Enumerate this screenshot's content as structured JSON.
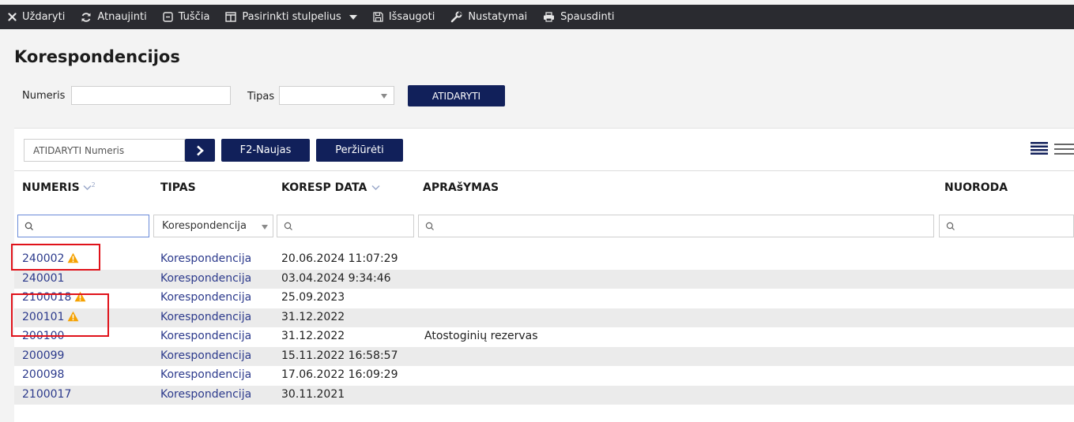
{
  "toolbar": {
    "items": [
      {
        "label": "Uždaryti",
        "icon": "close-icon"
      },
      {
        "label": "Atnaujinti",
        "icon": "refresh-icon"
      },
      {
        "label": "Tuščia",
        "icon": "empty-icon"
      },
      {
        "label": "Pasirinkti stulpelius",
        "icon": "columns-icon"
      },
      {
        "label": "Išsaugoti",
        "icon": "save-icon"
      },
      {
        "label": "Nustatymai",
        "icon": "wrench-icon"
      },
      {
        "label": "Spausdinti",
        "icon": "print-icon"
      }
    ]
  },
  "page": {
    "title": "Korespondencijos"
  },
  "filters": {
    "numeris_label": "Numeris",
    "numeris_value": "",
    "tipas_label": "Tipas",
    "tipas_value": "",
    "open_button": "ATIDARYTI"
  },
  "quickbar": {
    "open_placeholder": "ATIDARYTI Numeris",
    "new_button": "F2-Naujas",
    "view_button": "Peržiūrėti"
  },
  "table": {
    "columns": {
      "numeris": "NUMERIS",
      "numeris_sort": "2",
      "tipas": "TIPAS",
      "koresp_data": "KORESP DATA",
      "aprasymas": "APRAšYMAS",
      "nuoroda": "NUORODA"
    },
    "type_filter_value": "Korespondencija",
    "rows": [
      {
        "numeris": "240002",
        "warning": true,
        "tipas": "Korespondencija",
        "data": "20.06.2024 11:07:29",
        "aprasymas": ""
      },
      {
        "numeris": "240001",
        "warning": false,
        "tipas": "Korespondencija",
        "data": "03.04.2024 9:34:46",
        "aprasymas": ""
      },
      {
        "numeris": "2100018",
        "warning": true,
        "tipas": "Korespondencija",
        "data": "25.09.2023",
        "aprasymas": ""
      },
      {
        "numeris": "200101",
        "warning": true,
        "tipas": "Korespondencija",
        "data": "31.12.2022",
        "aprasymas": ""
      },
      {
        "numeris": "200100",
        "warning": false,
        "tipas": "Korespondencija",
        "data": "31.12.2022",
        "aprasymas": "Atostoginių rezervas"
      },
      {
        "numeris": "200099",
        "warning": false,
        "tipas": "Korespondencija",
        "data": "15.11.2022 16:58:57",
        "aprasymas": ""
      },
      {
        "numeris": "200098",
        "warning": false,
        "tipas": "Korespondencija",
        "data": "17.06.2022 16:09:29",
        "aprasymas": ""
      },
      {
        "numeris": "2100017",
        "warning": false,
        "tipas": "Korespondencija",
        "data": "30.11.2021",
        "aprasymas": ""
      }
    ]
  },
  "colors": {
    "toolbar_bg": "#2a2b30",
    "button_bg": "#11205a",
    "link": "#2c3a8c",
    "warning": "#f5a100",
    "highlight": "#e0121a"
  }
}
